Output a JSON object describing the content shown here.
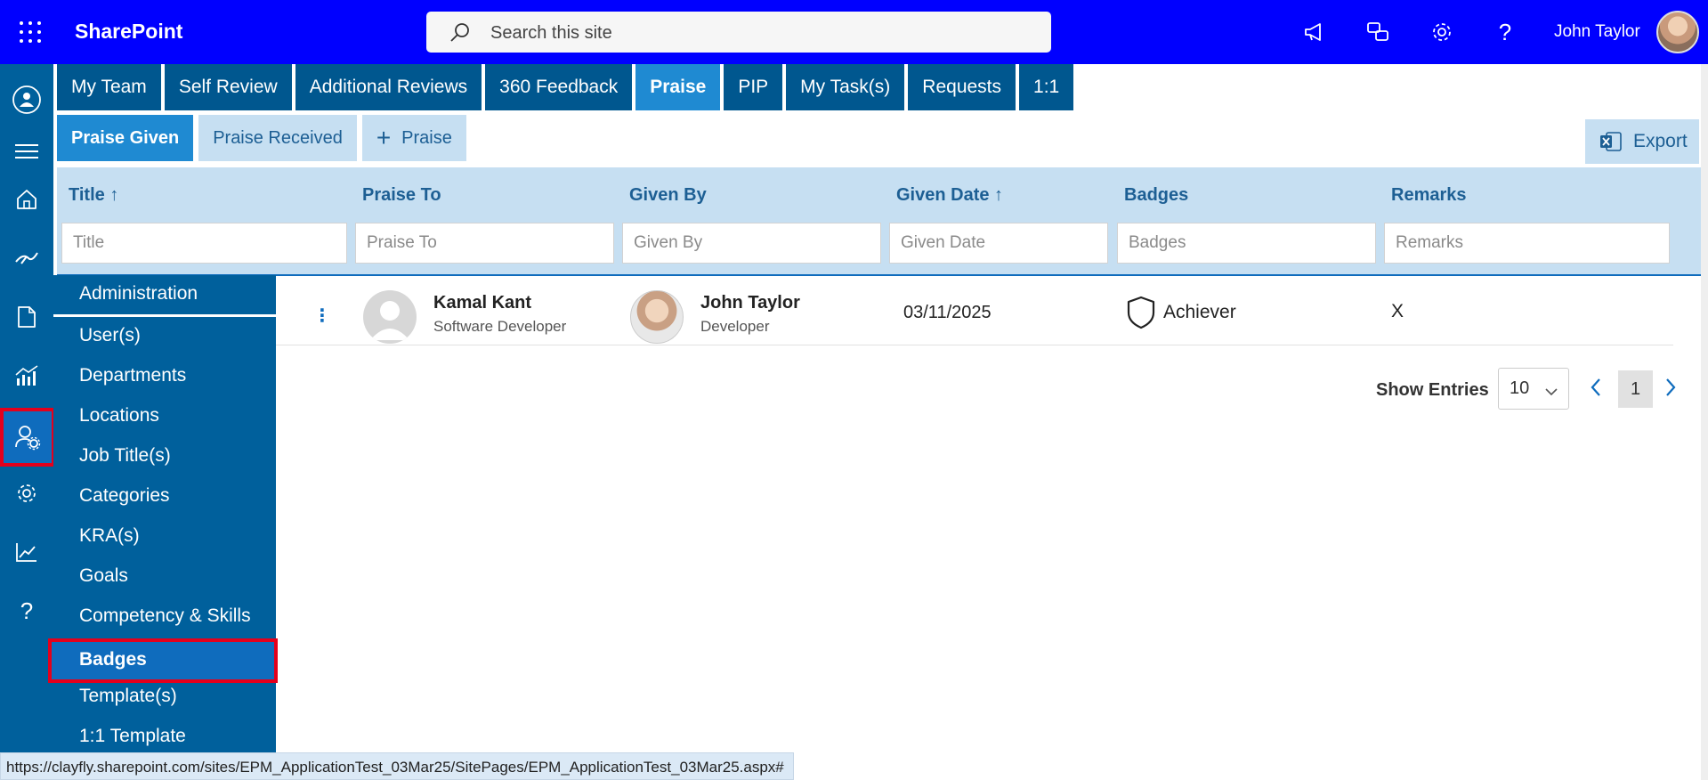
{
  "suite": {
    "app_name": "SharePoint",
    "search_placeholder": "Search this site",
    "user_name": "John Taylor"
  },
  "tabs": [
    {
      "label": "My Team",
      "active": false
    },
    {
      "label": "Self Review",
      "active": false
    },
    {
      "label": "Additional Reviews",
      "active": false
    },
    {
      "label": "360 Feedback",
      "active": false
    },
    {
      "label": "Praise",
      "active": true
    },
    {
      "label": "PIP",
      "active": false
    },
    {
      "label": "My Task(s)",
      "active": false
    },
    {
      "label": "Requests",
      "active": false
    },
    {
      "label": "1:1",
      "active": false
    }
  ],
  "subtabs": {
    "given": "Praise Given",
    "received": "Praise Received",
    "add": "Praise"
  },
  "export_label": "Export",
  "columns": {
    "title": "Title",
    "praise_to": "Praise To",
    "given_by": "Given By",
    "given_date": "Given Date",
    "badges": "Badges",
    "remarks": "Remarks"
  },
  "filters": {
    "title": "Title",
    "praise_to": "Praise To",
    "given_by": "Given By",
    "given_date": "Given Date",
    "badges": "Badges",
    "remarks": "Remarks"
  },
  "rows": [
    {
      "praise_to_name": "Kamal Kant",
      "praise_to_role": "Software Developer",
      "given_by_name": "John Taylor",
      "given_by_role": "Developer",
      "given_date": "03/11/2025",
      "badge": "Achiever",
      "remarks": "X"
    }
  ],
  "pagination": {
    "show_entries_label": "Show Entries",
    "page_size": "10",
    "current_page": "1"
  },
  "admin_menu": {
    "header": "Administration",
    "items": [
      "User(s)",
      "Departments",
      "Locations",
      "Job Title(s)",
      "Categories",
      "KRA(s)",
      "Goals",
      "Competency & Skills",
      "Badges",
      "Template(s)",
      "1:1 Template"
    ],
    "active": "Badges"
  },
  "status_url": "https://clayfly.sharepoint.com/sites/EPM_ApplicationTest_03Mar25/SitePages/EPM_ApplicationTest_03Mar25.aspx#",
  "colors": {
    "suite_bar": "#0000ff",
    "nav": "#00609c",
    "tab": "#00578f",
    "tab_active": "#1f8ad2",
    "header_bg": "#c6dff2",
    "highlight": "#e4001c"
  }
}
